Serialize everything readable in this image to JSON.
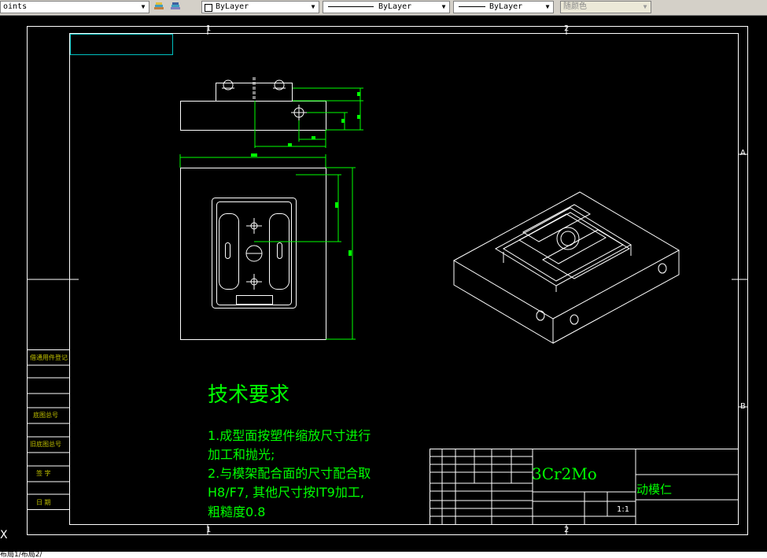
{
  "toolbar": {
    "points_label": "oints",
    "layer_color": "ByLayer",
    "linetype": "ByLayer",
    "lineweight": "ByLayer",
    "plotstyle": "随颜色"
  },
  "zones": {
    "top_1": "1",
    "top_2": "2",
    "bottom_1": "1",
    "bottom_2": "2",
    "right_a": "A",
    "right_b": "B"
  },
  "notes": {
    "title": "技术要求",
    "line1": "1.成型面按塑件缩放尺寸进行",
    "line2": "加工和抛光;",
    "line3": "2.与模架配合面的尺寸配合取",
    "line4": "H8/F7, 其他尺寸按IT9加工,",
    "line5": "粗糙度0.8"
  },
  "title_block": {
    "material": "3Cr2Mo",
    "part_name": "动模仁",
    "scale": "1:1"
  },
  "left_stamp": [
    "借通用件登记",
    "旧底图总号",
    "底图总号",
    "签 字",
    "日 期"
  ],
  "status_text": "布局1/布局2/",
  "cursor_glyph": "X",
  "colors": {
    "background": "#000000",
    "drawing": "#ffffff",
    "dimensions": "#00ff00",
    "frame_accent": "#00c0c0",
    "title_block_text": "#c0c000"
  }
}
